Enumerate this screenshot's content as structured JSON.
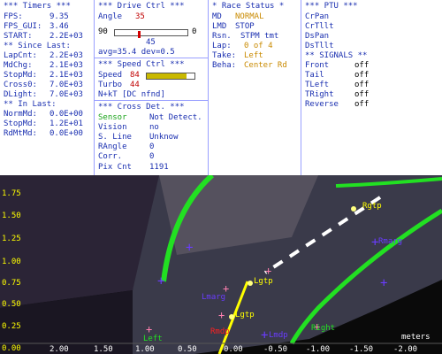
{
  "timers": {
    "title": "*** Timers ***",
    "fps_label": "FPS:",
    "fps_value": "9.35",
    "fps_gui_label": "FPS_GUI:",
    "fps_gui_value": "3.46",
    "start_label": "START:",
    "start_value": "2.2E+03",
    "since_last_title": "** Since Last:",
    "lapcnt_label": "LapCnt:",
    "lapcnt_value": "2.2E+03",
    "mdchg_label": "MdChg:",
    "mdchg_value": "2.1E+03",
    "stopmd_label": "StopMd:",
    "stopmd_value": "2.1E+03",
    "cross0_label": "Cross0:",
    "cross0_value": "7.0E+03",
    "dlight_label": "DLight:",
    "dlight_value": "7.0E+03",
    "in_last_title": "** In Last:",
    "normmd_label": "NormMd:",
    "normmd_value": "0.0E+00",
    "stopmd2_label": "StopMd:",
    "stopmd2_value": "1.2E+01",
    "rdmtmd_label": "RdMtMd:",
    "rdmtmd_value": "0.0E+00"
  },
  "drive": {
    "title": "*** Drive Ctrl ***",
    "angle_label": "Angle",
    "angle_value": "35",
    "slider_min": "90",
    "slider_max": "0",
    "slider_fraction": 0.32,
    "slider_center": "45",
    "avg_line": "avg=35.4  dev=0.5",
    "speed_title": "*** Speed Ctrl ***",
    "speed_label": "Speed",
    "speed_value": "84",
    "speed_fraction": 0.84,
    "turbo_label": "Turbo",
    "turbo_value": "44",
    "turbo_fraction": 0.44,
    "note": "N+kT [DC nfnd]",
    "cross_title": "*** Cross Det. ***",
    "sensor_label": "Sensor",
    "sensor_value": "Not Detect.",
    "vision_label": "Vision",
    "vision_value": "no",
    "sline_label": "S. Line",
    "sline_value": "Unknow",
    "rangle_label": "RAngle",
    "rangle_value": "0",
    "corr_label": "Corr.",
    "corr_value": "0",
    "pixcnt_label": "Pix Cnt",
    "pixcnt_value": "1191"
  },
  "race": {
    "title": "* Race Status *",
    "md_label": "MD",
    "md_value": "NORMAL",
    "lmd_label": "LMD",
    "lmd_value": "STOP",
    "rsn_label": "Rsn.",
    "rsn_value": "STPM tmt",
    "lap_label": "Lap:",
    "lap_value": "0 of 4",
    "take_label": "Take:",
    "take_value": "Left",
    "beha_label": "Beha:",
    "beha_value": "Center Rd"
  },
  "ptu": {
    "title": "*** PTU ***",
    "items": [
      "CrPan",
      "CrTllt",
      "DsPan",
      "DsTllt"
    ],
    "signals_title": "** SIGNALS **",
    "signals": [
      {
        "label": "Front",
        "value": "off"
      },
      {
        "label": "Tail",
        "value": "off"
      },
      {
        "label": "TLeft",
        "value": "off"
      },
      {
        "label": "TRight",
        "value": "off"
      },
      {
        "label": "Reverse",
        "value": "off"
      }
    ]
  },
  "view": {
    "y_ticks": [
      "1.75",
      "1.50",
      "1.25",
      "1.00",
      "0.75",
      "0.50",
      "0.25",
      "0.00"
    ],
    "x_ticks": [
      "2.00",
      "1.50",
      "1.00",
      "0.50",
      "0.00",
      "-0.50",
      "-1.00",
      "-1.50",
      "-2.00"
    ],
    "units": "meters",
    "labels": {
      "lgtp": "Lgtp",
      "lmarg": "Lmarg",
      "lmdp": "Lmdp",
      "rgtp": "Rgtp",
      "rmarg": "Rmarg",
      "rmdp": "Rmdp",
      "left": "Left",
      "right": "Right"
    }
  },
  "colors": {
    "header_blue": "#1a2fb0",
    "value_red": "#c00000",
    "value_orange": "#c98a00",
    "sensor_green": "#1aa31a",
    "lane_green": "#22e022",
    "axis_yellow": "#ffff00"
  }
}
